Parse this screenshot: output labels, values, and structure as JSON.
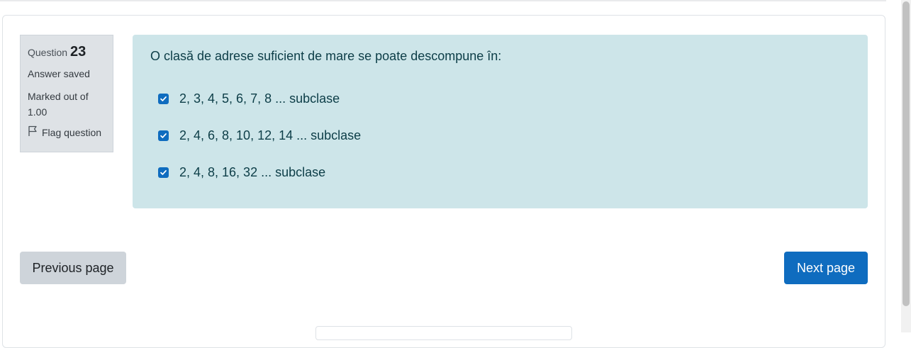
{
  "question_info": {
    "question_label": "Question",
    "question_number": "23",
    "state": "Answer saved",
    "grade": "Marked out of 1.00",
    "flag_label": "Flag question"
  },
  "question": {
    "text": "O clasă de adrese suficient de mare se poate descompune în:",
    "answers": [
      {
        "label": "2, 3, 4, 5, 6, 7, 8 ... subclase",
        "checked": true
      },
      {
        "label": "2, 4, 6, 8, 10, 12, 14 ... subclase",
        "checked": true
      },
      {
        "label": "2, 4, 8, 16, 32 ... subclase",
        "checked": true
      }
    ]
  },
  "navigation": {
    "previous_label": "Previous page",
    "next_label": "Next page"
  },
  "colors": {
    "primary": "#0f6cbf",
    "content_bg": "#cde5e9",
    "info_bg": "#dee2e6",
    "secondary_button": "#ced4da"
  }
}
